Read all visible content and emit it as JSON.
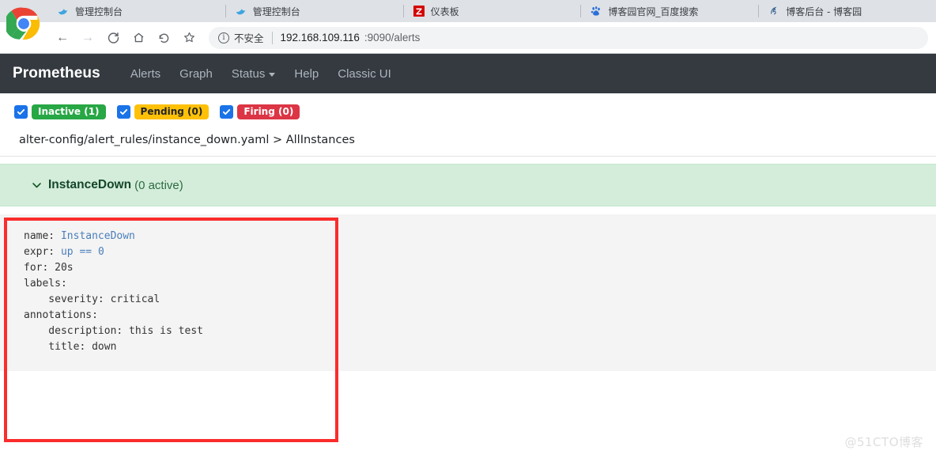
{
  "browser": {
    "tabs": [
      {
        "title": "管理控制台",
        "favicon": "bird-icon",
        "active": true
      },
      {
        "title": "管理控制台",
        "favicon": "bird-icon",
        "active": false
      },
      {
        "title": "仪表板",
        "favicon": "zabbix-z-icon",
        "active": false
      },
      {
        "title": "博客园官网_百度搜索",
        "favicon": "baidu-paw-icon",
        "active": false
      },
      {
        "title": "博客后台 - 博客园",
        "favicon": "cnblogs-icon",
        "active": false
      }
    ],
    "toolbar": {
      "back": "←",
      "forward": "→",
      "reload": "C",
      "home": "⌂",
      "history": "↺",
      "bookmark": "☆"
    },
    "omnibox": {
      "security_label": "不安全",
      "url_host": "192.168.109.116",
      "url_rest": ":9090/alerts"
    }
  },
  "prometheus": {
    "brand": "Prometheus",
    "nav": [
      {
        "label": "Alerts",
        "has_caret": false
      },
      {
        "label": "Graph",
        "has_caret": false
      },
      {
        "label": "Status",
        "has_caret": true
      },
      {
        "label": "Help",
        "has_caret": false
      },
      {
        "label": "Classic UI",
        "has_caret": false
      }
    ],
    "filters": [
      {
        "label": "Inactive (1)",
        "state": "inactive",
        "checked": true
      },
      {
        "label": "Pending (0)",
        "state": "pending",
        "checked": true
      },
      {
        "label": "Firing (0)",
        "state": "firing",
        "checked": true
      }
    ],
    "breadcrumb": {
      "file": "alter-config/alert_rules/instance_down.yaml",
      "separator": ">",
      "group": "AllInstances"
    },
    "alert": {
      "name": "InstanceDown",
      "active_text": "(0 active)",
      "chevron": "chevron-down-icon",
      "rule_yaml": {
        "name_key": "name:",
        "name_value": "InstanceDown",
        "expr_key": "expr:",
        "expr_metric": "up",
        "expr_op": "==",
        "expr_num": "0",
        "for_line": "for: 20s",
        "labels_line": "labels:",
        "severity_line": "    severity: critical",
        "annotations_line": "annotations:",
        "description_line": "    description: this is test",
        "title_line": "    title: down"
      }
    }
  },
  "watermark": "@51CTO博客",
  "colors": {
    "navbar_bg": "#343a40",
    "inactive_green": "#28a745",
    "pending_yellow": "#ffc107",
    "firing_red": "#dc3545",
    "alert_panel_bg": "#d4edda",
    "code_bg": "#f4f4f4",
    "annotation_red": "#fb2c2c",
    "checkbox_blue": "#1a73e8"
  }
}
